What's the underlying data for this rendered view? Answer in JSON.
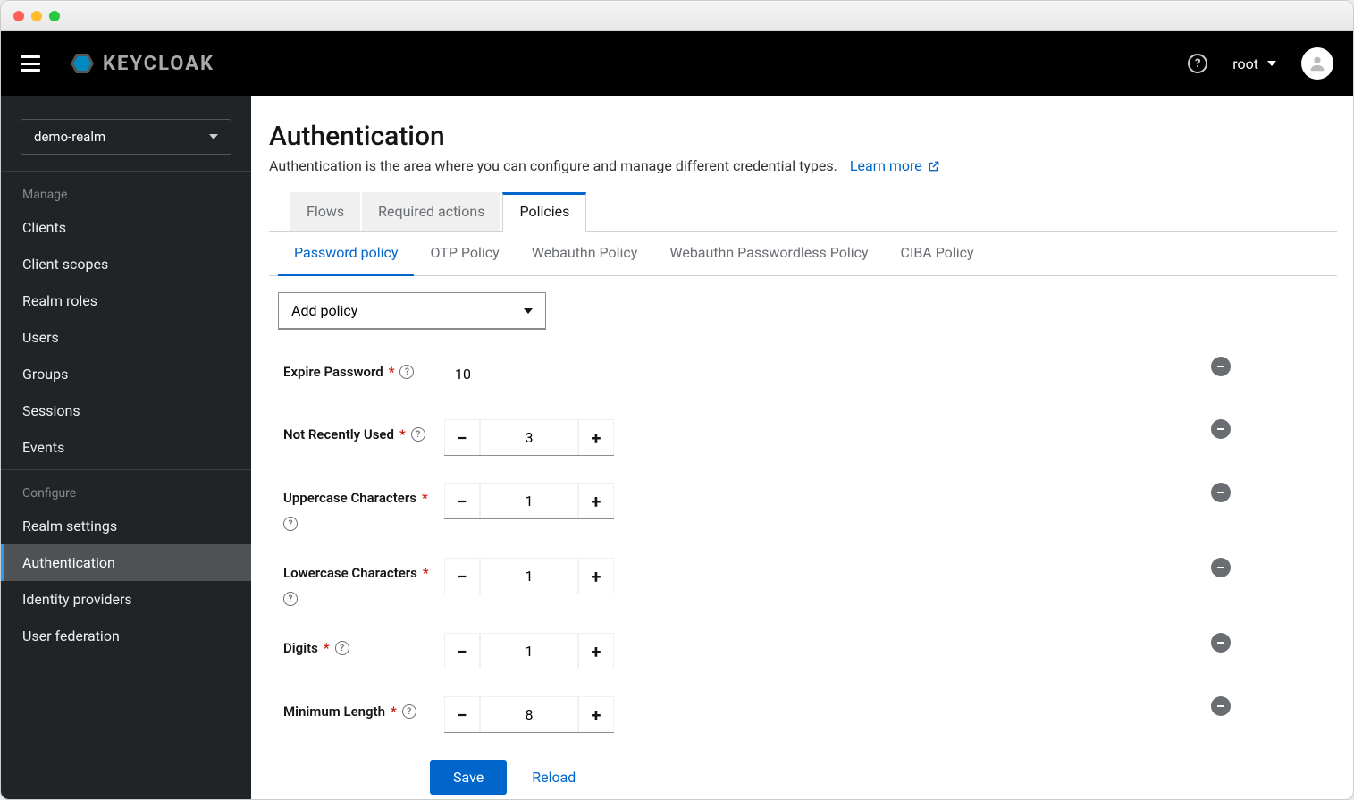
{
  "header": {
    "brand": "KEYCLOAK",
    "user": "root"
  },
  "sidebar": {
    "realm": "demo-realm",
    "sections": [
      {
        "title": "Manage",
        "items": [
          "Clients",
          "Client scopes",
          "Realm roles",
          "Users",
          "Groups",
          "Sessions",
          "Events"
        ]
      },
      {
        "title": "Configure",
        "items": [
          "Realm settings",
          "Authentication",
          "Identity providers",
          "User federation"
        ],
        "activeIndex": 1
      }
    ]
  },
  "page": {
    "title": "Authentication",
    "desc": "Authentication is the area where you can configure and manage different credential types.",
    "learnMore": "Learn more"
  },
  "tabsPrimary": {
    "items": [
      "Flows",
      "Required actions",
      "Policies"
    ],
    "active": 2
  },
  "tabsSecondary": {
    "items": [
      "Password policy",
      "OTP Policy",
      "Webauthn Policy",
      "Webauthn Passwordless Policy",
      "CIBA Policy"
    ],
    "active": 0
  },
  "addPolicy": "Add policy",
  "policies": [
    {
      "label": "Expire Password",
      "type": "text",
      "value": "10"
    },
    {
      "label": "Not Recently Used",
      "type": "stepper",
      "value": "3"
    },
    {
      "label": "Uppercase Characters",
      "type": "stepper",
      "value": "1",
      "helpBelow": true
    },
    {
      "label": "Lowercase Characters",
      "type": "stepper",
      "value": "1",
      "helpBelow": true
    },
    {
      "label": "Digits",
      "type": "stepper",
      "value": "1"
    },
    {
      "label": "Minimum Length",
      "type": "stepper",
      "value": "8"
    }
  ],
  "buttons": {
    "save": "Save",
    "reload": "Reload"
  }
}
